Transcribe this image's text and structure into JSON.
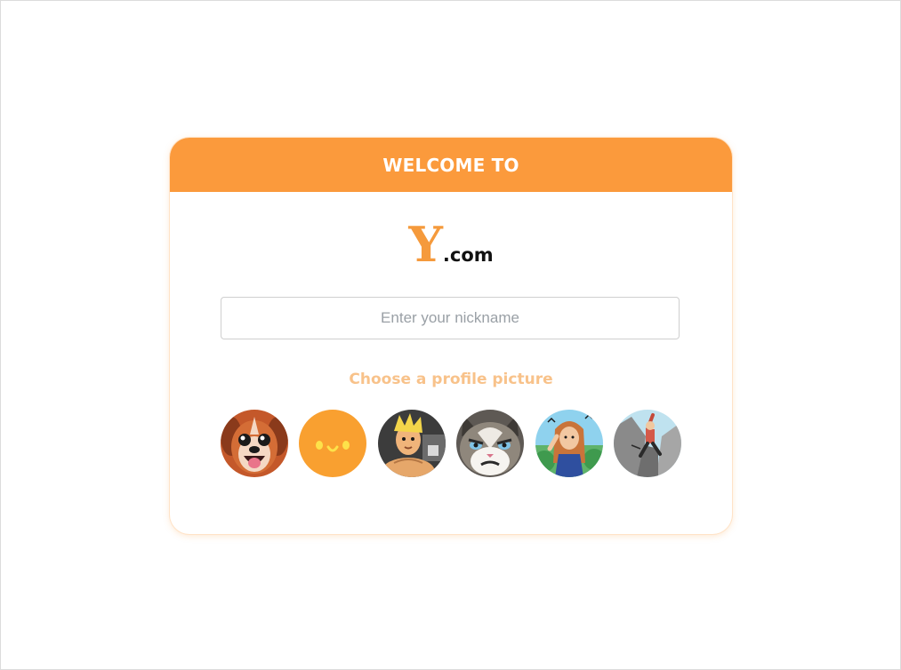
{
  "header": {
    "title": "WELCOME TO"
  },
  "logo": {
    "letter": "Y",
    "suffix": ".com"
  },
  "nickname": {
    "placeholder": "Enter your nickname",
    "value": ""
  },
  "profile": {
    "label": "Choose a profile picture",
    "avatars": [
      {
        "name": "dog-avatar"
      },
      {
        "name": "orange-smiley-avatar"
      },
      {
        "name": "muscle-man-avatar"
      },
      {
        "name": "grumpy-cat-avatar"
      },
      {
        "name": "woman-nature-avatar"
      },
      {
        "name": "climber-avatar"
      }
    ]
  },
  "colors": {
    "accent": "#fb9a3c",
    "label": "#f8c28a",
    "logo_y": "#f59a3c"
  }
}
